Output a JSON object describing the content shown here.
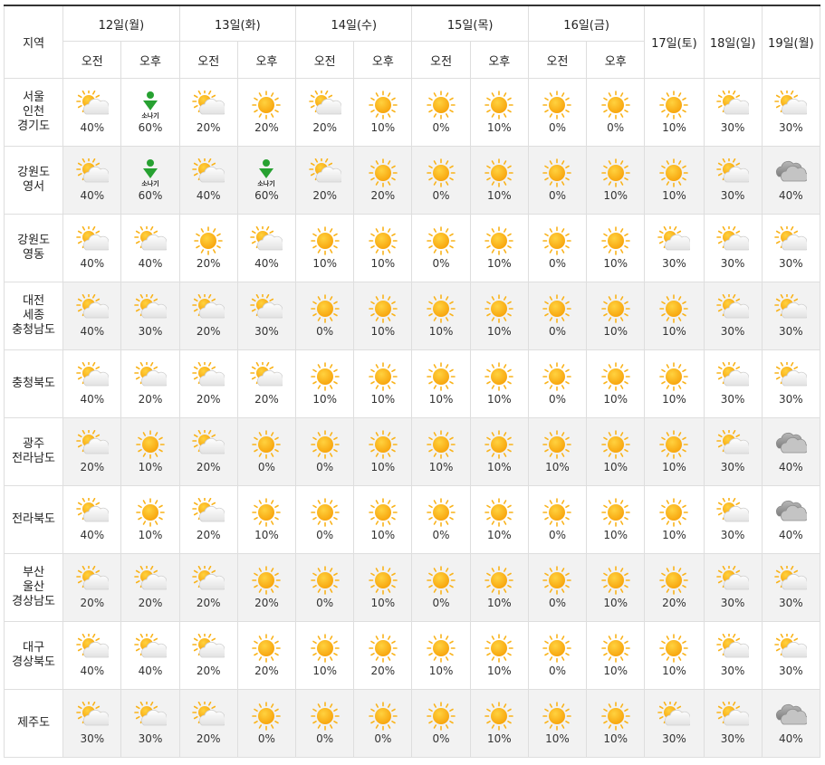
{
  "header": {
    "region_label": "지역",
    "days": [
      {
        "label": "12일(월)",
        "split": true
      },
      {
        "label": "13일(화)",
        "split": true
      },
      {
        "label": "14일(수)",
        "split": true
      },
      {
        "label": "15일(목)",
        "split": true
      },
      {
        "label": "16일(금)",
        "split": true
      },
      {
        "label": "17일(토)",
        "split": false
      },
      {
        "label": "18일(일)",
        "split": false
      },
      {
        "label": "19일(월)",
        "split": false
      }
    ],
    "am_label": "오전",
    "pm_label": "오후"
  },
  "shower_text": "소나기",
  "rows": [
    {
      "region": [
        "서울",
        "인천",
        "경기도"
      ],
      "cells": [
        {
          "icon": "partly-cloudy-icon",
          "pct": "40%"
        },
        {
          "icon": "shower-icon",
          "pct": "60%"
        },
        {
          "icon": "partly-cloudy-icon",
          "pct": "20%"
        },
        {
          "icon": "sunny-icon",
          "pct": "20%"
        },
        {
          "icon": "partly-cloudy-icon",
          "pct": "20%"
        },
        {
          "icon": "sunny-icon",
          "pct": "10%"
        },
        {
          "icon": "sunny-icon",
          "pct": "0%"
        },
        {
          "icon": "sunny-icon",
          "pct": "10%"
        },
        {
          "icon": "sunny-icon",
          "pct": "0%"
        },
        {
          "icon": "sunny-icon",
          "pct": "0%"
        },
        {
          "icon": "sunny-icon",
          "pct": "10%"
        },
        {
          "icon": "partly-cloudy-icon",
          "pct": "30%"
        },
        {
          "icon": "partly-cloudy-icon",
          "pct": "30%"
        }
      ]
    },
    {
      "region": [
        "강원도",
        "영서"
      ],
      "cells": [
        {
          "icon": "partly-cloudy-icon",
          "pct": "40%"
        },
        {
          "icon": "shower-icon",
          "pct": "60%"
        },
        {
          "icon": "partly-cloudy-icon",
          "pct": "40%"
        },
        {
          "icon": "shower-icon",
          "pct": "60%"
        },
        {
          "icon": "partly-cloudy-icon",
          "pct": "20%"
        },
        {
          "icon": "sunny-icon",
          "pct": "20%"
        },
        {
          "icon": "sunny-icon",
          "pct": "0%"
        },
        {
          "icon": "sunny-icon",
          "pct": "10%"
        },
        {
          "icon": "sunny-icon",
          "pct": "0%"
        },
        {
          "icon": "sunny-icon",
          "pct": "10%"
        },
        {
          "icon": "sunny-icon",
          "pct": "10%"
        },
        {
          "icon": "partly-cloudy-icon",
          "pct": "30%"
        },
        {
          "icon": "cloudy-icon",
          "pct": "40%"
        }
      ]
    },
    {
      "region": [
        "강원도",
        "영동"
      ],
      "cells": [
        {
          "icon": "partly-cloudy-icon",
          "pct": "40%"
        },
        {
          "icon": "partly-cloudy-icon",
          "pct": "40%"
        },
        {
          "icon": "sunny-icon",
          "pct": "20%"
        },
        {
          "icon": "partly-cloudy-icon",
          "pct": "40%"
        },
        {
          "icon": "sunny-icon",
          "pct": "10%"
        },
        {
          "icon": "sunny-icon",
          "pct": "10%"
        },
        {
          "icon": "sunny-icon",
          "pct": "0%"
        },
        {
          "icon": "sunny-icon",
          "pct": "10%"
        },
        {
          "icon": "sunny-icon",
          "pct": "0%"
        },
        {
          "icon": "sunny-icon",
          "pct": "10%"
        },
        {
          "icon": "partly-cloudy-icon",
          "pct": "30%"
        },
        {
          "icon": "partly-cloudy-icon",
          "pct": "30%"
        },
        {
          "icon": "partly-cloudy-icon",
          "pct": "30%"
        }
      ]
    },
    {
      "region": [
        "대전",
        "세종",
        "충청남도"
      ],
      "cells": [
        {
          "icon": "partly-cloudy-icon",
          "pct": "40%"
        },
        {
          "icon": "partly-cloudy-icon",
          "pct": "30%"
        },
        {
          "icon": "partly-cloudy-icon",
          "pct": "20%"
        },
        {
          "icon": "partly-cloudy-icon",
          "pct": "30%"
        },
        {
          "icon": "sunny-icon",
          "pct": "0%"
        },
        {
          "icon": "sunny-icon",
          "pct": "10%"
        },
        {
          "icon": "sunny-icon",
          "pct": "10%"
        },
        {
          "icon": "sunny-icon",
          "pct": "10%"
        },
        {
          "icon": "sunny-icon",
          "pct": "0%"
        },
        {
          "icon": "sunny-icon",
          "pct": "10%"
        },
        {
          "icon": "sunny-icon",
          "pct": "10%"
        },
        {
          "icon": "partly-cloudy-icon",
          "pct": "30%"
        },
        {
          "icon": "partly-cloudy-icon",
          "pct": "30%"
        }
      ]
    },
    {
      "region": [
        "충청북도"
      ],
      "cells": [
        {
          "icon": "partly-cloudy-icon",
          "pct": "40%"
        },
        {
          "icon": "partly-cloudy-icon",
          "pct": "20%"
        },
        {
          "icon": "partly-cloudy-icon",
          "pct": "20%"
        },
        {
          "icon": "partly-cloudy-icon",
          "pct": "20%"
        },
        {
          "icon": "sunny-icon",
          "pct": "10%"
        },
        {
          "icon": "sunny-icon",
          "pct": "10%"
        },
        {
          "icon": "sunny-icon",
          "pct": "10%"
        },
        {
          "icon": "sunny-icon",
          "pct": "10%"
        },
        {
          "icon": "sunny-icon",
          "pct": "0%"
        },
        {
          "icon": "sunny-icon",
          "pct": "10%"
        },
        {
          "icon": "sunny-icon",
          "pct": "10%"
        },
        {
          "icon": "partly-cloudy-icon",
          "pct": "30%"
        },
        {
          "icon": "partly-cloudy-icon",
          "pct": "30%"
        }
      ]
    },
    {
      "region": [
        "광주",
        "전라남도"
      ],
      "cells": [
        {
          "icon": "partly-cloudy-icon",
          "pct": "20%"
        },
        {
          "icon": "sunny-icon",
          "pct": "10%"
        },
        {
          "icon": "partly-cloudy-icon",
          "pct": "20%"
        },
        {
          "icon": "sunny-icon",
          "pct": "0%"
        },
        {
          "icon": "sunny-icon",
          "pct": "0%"
        },
        {
          "icon": "sunny-icon",
          "pct": "10%"
        },
        {
          "icon": "sunny-icon",
          "pct": "10%"
        },
        {
          "icon": "sunny-icon",
          "pct": "10%"
        },
        {
          "icon": "sunny-icon",
          "pct": "10%"
        },
        {
          "icon": "sunny-icon",
          "pct": "10%"
        },
        {
          "icon": "sunny-icon",
          "pct": "10%"
        },
        {
          "icon": "partly-cloudy-icon",
          "pct": "30%"
        },
        {
          "icon": "cloudy-icon",
          "pct": "40%"
        }
      ]
    },
    {
      "region": [
        "전라북도"
      ],
      "cells": [
        {
          "icon": "partly-cloudy-icon",
          "pct": "40%"
        },
        {
          "icon": "sunny-icon",
          "pct": "10%"
        },
        {
          "icon": "partly-cloudy-icon",
          "pct": "20%"
        },
        {
          "icon": "sunny-icon",
          "pct": "10%"
        },
        {
          "icon": "sunny-icon",
          "pct": "0%"
        },
        {
          "icon": "sunny-icon",
          "pct": "10%"
        },
        {
          "icon": "sunny-icon",
          "pct": "0%"
        },
        {
          "icon": "sunny-icon",
          "pct": "10%"
        },
        {
          "icon": "sunny-icon",
          "pct": "0%"
        },
        {
          "icon": "sunny-icon",
          "pct": "10%"
        },
        {
          "icon": "sunny-icon",
          "pct": "10%"
        },
        {
          "icon": "partly-cloudy-icon",
          "pct": "30%"
        },
        {
          "icon": "cloudy-icon",
          "pct": "40%"
        }
      ]
    },
    {
      "region": [
        "부산",
        "울산",
        "경상남도"
      ],
      "cells": [
        {
          "icon": "partly-cloudy-icon",
          "pct": "20%"
        },
        {
          "icon": "partly-cloudy-icon",
          "pct": "20%"
        },
        {
          "icon": "partly-cloudy-icon",
          "pct": "20%"
        },
        {
          "icon": "sunny-icon",
          "pct": "20%"
        },
        {
          "icon": "sunny-icon",
          "pct": "0%"
        },
        {
          "icon": "sunny-icon",
          "pct": "10%"
        },
        {
          "icon": "sunny-icon",
          "pct": "0%"
        },
        {
          "icon": "sunny-icon",
          "pct": "10%"
        },
        {
          "icon": "sunny-icon",
          "pct": "0%"
        },
        {
          "icon": "sunny-icon",
          "pct": "10%"
        },
        {
          "icon": "sunny-icon",
          "pct": "20%"
        },
        {
          "icon": "partly-cloudy-icon",
          "pct": "30%"
        },
        {
          "icon": "partly-cloudy-icon",
          "pct": "30%"
        }
      ]
    },
    {
      "region": [
        "대구",
        "경상북도"
      ],
      "cells": [
        {
          "icon": "partly-cloudy-icon",
          "pct": "40%"
        },
        {
          "icon": "partly-cloudy-icon",
          "pct": "40%"
        },
        {
          "icon": "partly-cloudy-icon",
          "pct": "20%"
        },
        {
          "icon": "sunny-icon",
          "pct": "20%"
        },
        {
          "icon": "sunny-icon",
          "pct": "10%"
        },
        {
          "icon": "sunny-icon",
          "pct": "20%"
        },
        {
          "icon": "sunny-icon",
          "pct": "10%"
        },
        {
          "icon": "sunny-icon",
          "pct": "10%"
        },
        {
          "icon": "sunny-icon",
          "pct": "0%"
        },
        {
          "icon": "sunny-icon",
          "pct": "10%"
        },
        {
          "icon": "sunny-icon",
          "pct": "10%"
        },
        {
          "icon": "partly-cloudy-icon",
          "pct": "30%"
        },
        {
          "icon": "partly-cloudy-icon",
          "pct": "30%"
        }
      ]
    },
    {
      "region": [
        "제주도"
      ],
      "cells": [
        {
          "icon": "partly-cloudy-icon",
          "pct": "30%"
        },
        {
          "icon": "partly-cloudy-icon",
          "pct": "30%"
        },
        {
          "icon": "partly-cloudy-icon",
          "pct": "20%"
        },
        {
          "icon": "sunny-icon",
          "pct": "0%"
        },
        {
          "icon": "sunny-icon",
          "pct": "0%"
        },
        {
          "icon": "sunny-icon",
          "pct": "0%"
        },
        {
          "icon": "sunny-icon",
          "pct": "0%"
        },
        {
          "icon": "sunny-icon",
          "pct": "10%"
        },
        {
          "icon": "sunny-icon",
          "pct": "10%"
        },
        {
          "icon": "sunny-icon",
          "pct": "10%"
        },
        {
          "icon": "partly-cloudy-icon",
          "pct": "30%"
        },
        {
          "icon": "partly-cloudy-icon",
          "pct": "30%"
        },
        {
          "icon": "cloudy-icon",
          "pct": "40%"
        }
      ]
    }
  ],
  "colors": {
    "sun": "#fbb40f",
    "sun_ray": "#f9b31b",
    "cloud": "#f4f4f4",
    "cloud_dark": "#9a9a9a",
    "shower": "#27a131",
    "alt_row_bg": "#f2f2f2",
    "border": "#dedede"
  }
}
